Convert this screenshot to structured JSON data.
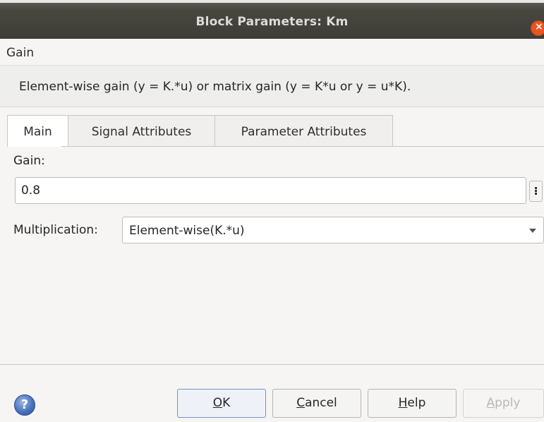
{
  "window": {
    "title": "Block Parameters: Km",
    "close_icon": "close-icon"
  },
  "block": {
    "type": "Gain",
    "description": "Element-wise gain (y = K.*u) or matrix gain (y = K*u or y = u*K)."
  },
  "tabs": [
    {
      "label": "Main",
      "active": true
    },
    {
      "label": "Signal Attributes",
      "active": false
    },
    {
      "label": "Parameter Attributes",
      "active": false
    }
  ],
  "main": {
    "gain_label": "Gain:",
    "gain_value": "0.8",
    "more_label": "⁝",
    "multiplication_label": "Multiplication:",
    "multiplication_value": "Element-wise(K.*u)"
  },
  "buttons": {
    "help_icon": "?",
    "ok": {
      "mnemonic": "O",
      "rest": "K"
    },
    "cancel": {
      "mnemonic": "C",
      "rest": "ancel"
    },
    "help": {
      "mnemonic": "H",
      "rest": "elp"
    },
    "apply": {
      "mnemonic": "A",
      "rest": "pply",
      "disabled": true
    }
  },
  "colors": {
    "titlebar": "#3d3c37",
    "close_button": "#e95420",
    "default_button_border": "#6f94c6"
  }
}
